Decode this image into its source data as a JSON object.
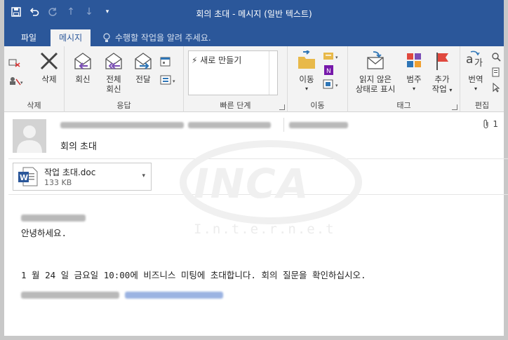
{
  "window": {
    "title": "회의 초대 - 메시지 (일반 텍스트)"
  },
  "tabs": [
    {
      "label": "파일"
    },
    {
      "label": "메시지"
    }
  ],
  "tell_me": {
    "placeholder": "수행할 작업을 알려 주세요."
  },
  "ribbon": {
    "delete_group": {
      "label": "삭제",
      "delete_label": "삭제"
    },
    "respond_group": {
      "label": "응답",
      "reply": "회신",
      "reply_all_1": "전체",
      "reply_all_2": "회신",
      "forward": "전달"
    },
    "quick_steps_group": {
      "label": "빠른 단계",
      "item": "새로 만들기"
    },
    "move_group": {
      "label": "이동",
      "move": "이동"
    },
    "tags_group": {
      "label": "태그",
      "unread_1": "읽지 않은",
      "unread_2": "상태로 표시",
      "categorize": "범주",
      "followup_1": "추가",
      "followup_2": "작업"
    },
    "editing_group": {
      "label": "편집",
      "translate": "번역"
    }
  },
  "message": {
    "subject": "회의 초대",
    "attachment_count": "1",
    "attachment": {
      "name": "작업 초대.doc",
      "size": "133 KB"
    },
    "greeting": "안녕하세요.",
    "body": "1 월 24 일 금요일 10:00에 비즈니스 미팅에 초대합니다. 회의 질문을 확인하십시오."
  },
  "watermark": {
    "brand": "INCA",
    "sub": "I.n.t.e.r.n.e.t"
  },
  "colors": {
    "accent": "#2b579a",
    "reply_purple": "#7b4fb6",
    "forward_blue": "#2e75b6",
    "flag_red": "#e0483e"
  }
}
